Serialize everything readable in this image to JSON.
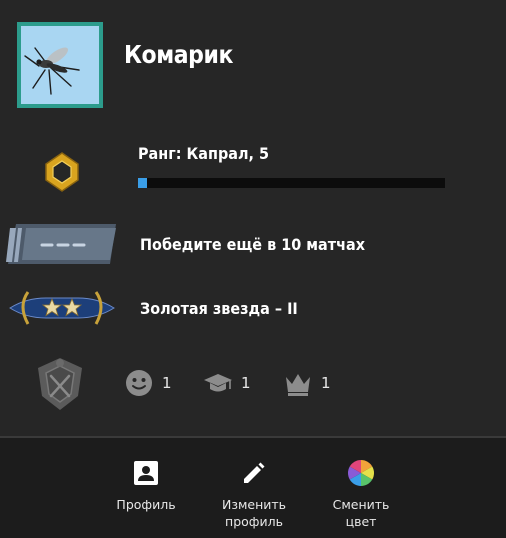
{
  "profile": {
    "username": "Комарик"
  },
  "rank": {
    "label": "Ранг: Капрал, 5",
    "progress": 0.03
  },
  "wins": {
    "text": "Победите ещё в 10 матчах"
  },
  "skill_group": {
    "text": "Золотая звезда – II"
  },
  "commendations": [
    {
      "icon": "smiley-icon",
      "value": "1"
    },
    {
      "icon": "graduation-cap-icon",
      "value": "1"
    },
    {
      "icon": "crown-icon",
      "value": "1"
    }
  ],
  "actions": [
    {
      "icon": "profile-icon",
      "label": "Профиль"
    },
    {
      "icon": "pencil-icon",
      "label": "Изменить\nпрофиль"
    },
    {
      "icon": "color-wheel-icon",
      "label": "Сменить\nцвет"
    }
  ],
  "colors": {
    "background": "#262626",
    "avatar_border": "#2c9c8c",
    "progress_fill": "#3a9ee8",
    "bottom_bar": "#1c1c1c"
  }
}
